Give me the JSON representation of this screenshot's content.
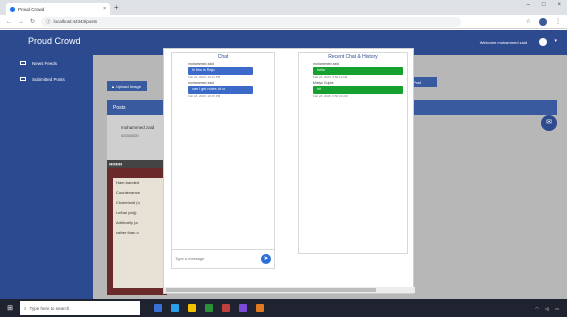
{
  "browser": {
    "tab_title": "Proud Crowd",
    "tab_close": "×",
    "new_tab": "+",
    "url": "localhost:44343/posts",
    "window_controls": [
      "–",
      "□",
      "×"
    ]
  },
  "app": {
    "brand": "Proud Crowd",
    "welcome": "Welcome mohammed zaid"
  },
  "sidebar": {
    "items": [
      {
        "label": "News Feeds"
      },
      {
        "label": "Submitted Posts"
      }
    ]
  },
  "content": {
    "upload_label": "Upload Image",
    "right_button_label": "Post",
    "posts_header": "Posts",
    "post_user": "mohammed zaid",
    "post_date": "02/24/2020",
    "post_image_text": [
      "Ham-handed",
      "Countenance",
      "Chokehold (n",
      "Lethal (adj):",
      "Arbitrarily (a",
      "rather than o"
    ]
  },
  "chat": {
    "title": "Chat",
    "messages": [
      {
        "user": "mohammed zaid",
        "text": "hi this is Rajo",
        "time": "Feb 24, 2020, 10:13 PM"
      },
      {
        "user": "mohammed zaid",
        "text": "can i get notes of cr",
        "time": "Feb 24, 2020, 10:15 PM"
      }
    ],
    "input_placeholder": "Type a message"
  },
  "recent": {
    "title": "Recent Chat & History",
    "messages": [
      {
        "user": "mohammed zaid",
        "text": "hello",
        "time": "Feb 24, 2020, 9:50:11 AM"
      },
      {
        "user": "Mistys Gupta",
        "text": "hii",
        "time": "Feb 24, 2020, 9:50:31 AM"
      }
    ]
  },
  "taskbar": {
    "search_placeholder": "Type here to search"
  },
  "colors": {
    "brand": "#2e4a8f",
    "chat_bubble": "#3b6ac8",
    "recent_bubble": "#15a02f"
  }
}
